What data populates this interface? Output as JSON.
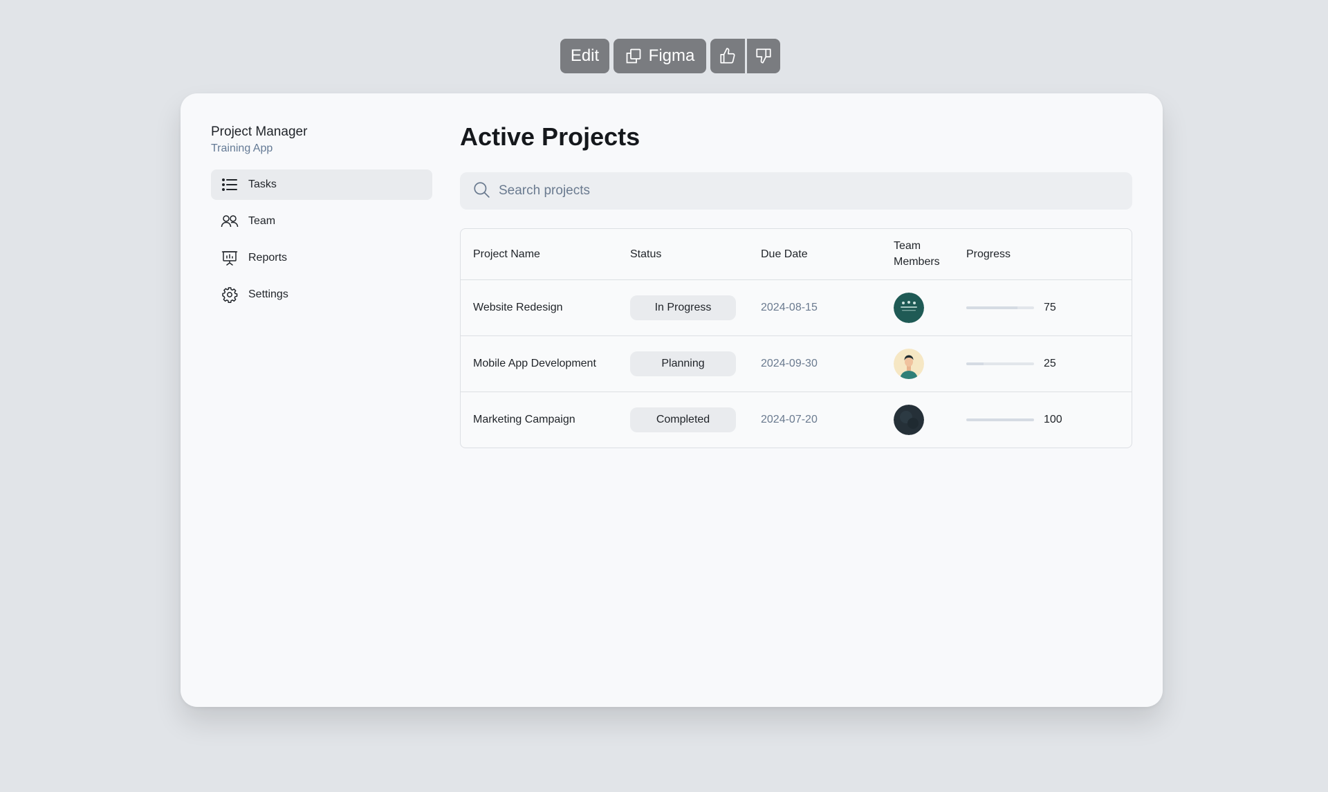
{
  "toolbar": {
    "edit_label": "Edit",
    "figma_label": "Figma",
    "icons": [
      "copy-icon",
      "thumbs-up-icon",
      "thumbs-down-icon"
    ]
  },
  "sidebar": {
    "title": "Project Manager",
    "subtitle": "Training App",
    "items": [
      {
        "label": "Tasks",
        "icon": "list-icon",
        "active": true
      },
      {
        "label": "Team",
        "icon": "users-icon",
        "active": false
      },
      {
        "label": "Reports",
        "icon": "presentation-chart-icon",
        "active": false
      },
      {
        "label": "Settings",
        "icon": "gear-icon",
        "active": false
      }
    ]
  },
  "main": {
    "title": "Active Projects",
    "search_placeholder": "Search projects",
    "table": {
      "headers": {
        "name": "Project Name",
        "status": "Status",
        "due": "Due Date",
        "team_line1": "Team",
        "team_line2": "Members",
        "progress": "Progress"
      },
      "rows": [
        {
          "name": "Website Redesign",
          "status": "In Progress",
          "due": "2024-08-15",
          "progress": "75",
          "progress_value": 75
        },
        {
          "name": "Mobile App Development",
          "status": "Planning",
          "due": "2024-09-30",
          "progress": "25",
          "progress_value": 25
        },
        {
          "name": "Marketing Campaign",
          "status": "Completed",
          "due": "2024-07-20",
          "progress": "100",
          "progress_value": 100
        }
      ]
    }
  },
  "colors": {
    "background": "#e1e4e8",
    "card": "#f8f9fb",
    "toolbar_button": "#7a7c80",
    "active_nav": "#e9ebee",
    "muted_text": "#6a7a8f"
  }
}
